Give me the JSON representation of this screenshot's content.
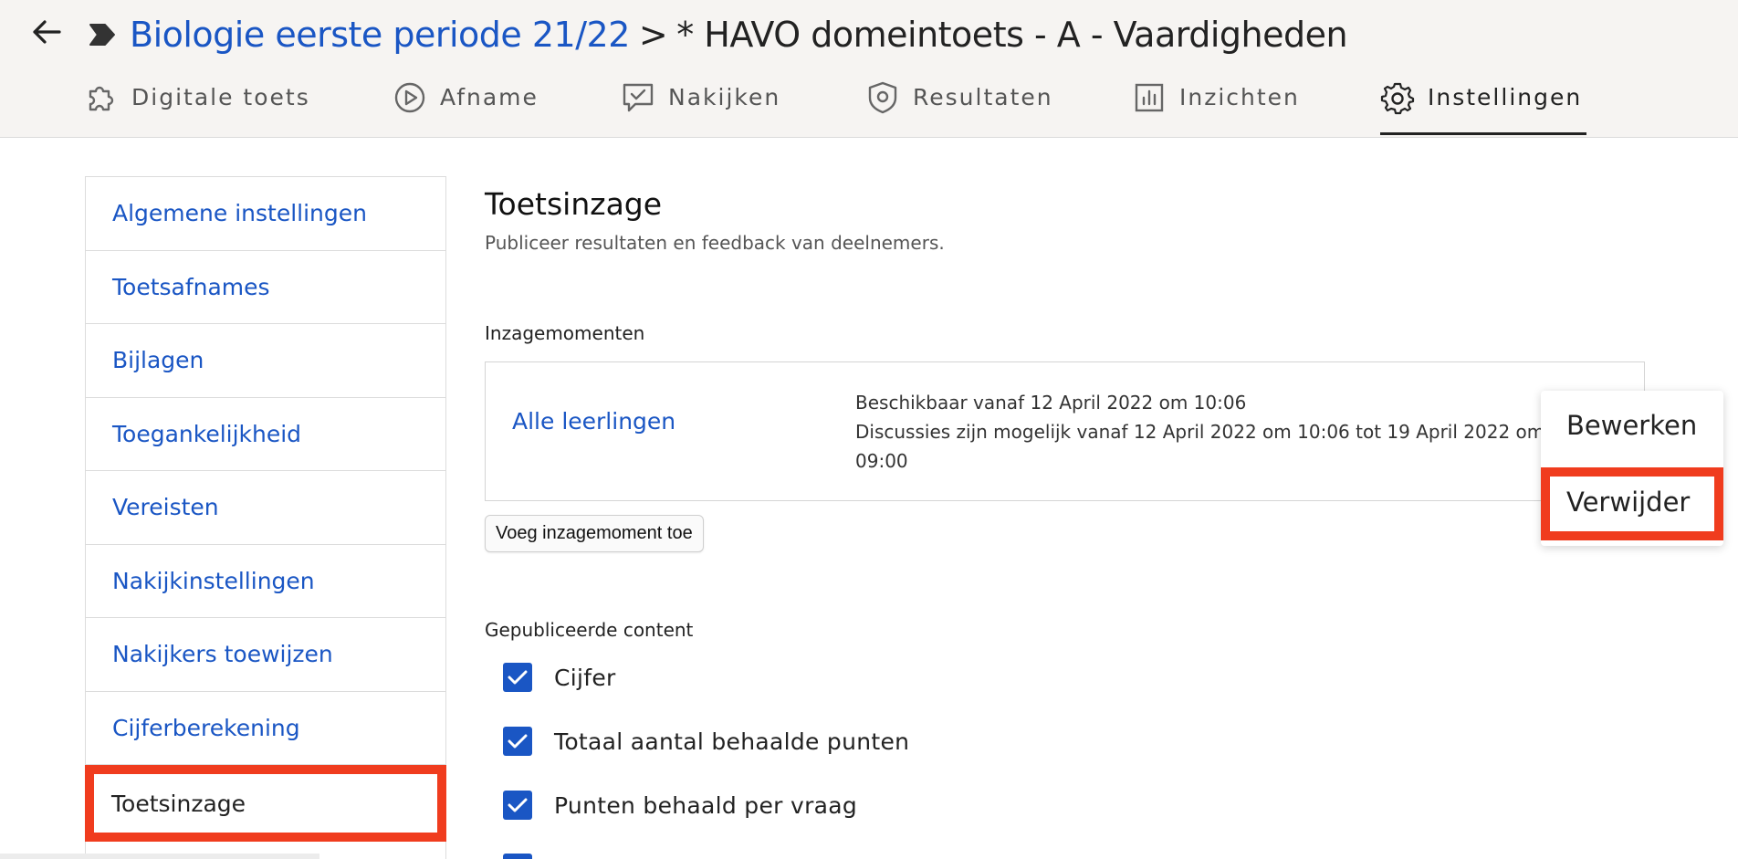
{
  "breadcrumb": {
    "parent": "Biologie eerste periode 21/22",
    "separator": ">",
    "current": "* HAVO domeintoets - A - Vaardigheden"
  },
  "tabs": [
    {
      "label": "Digitale toets",
      "icon": "puzzle-icon"
    },
    {
      "label": "Afname",
      "icon": "play-circle-icon"
    },
    {
      "label": "Nakijken",
      "icon": "chat-check-icon"
    },
    {
      "label": "Resultaten",
      "icon": "shield-icon"
    },
    {
      "label": "Inzichten",
      "icon": "bar-chart-icon"
    },
    {
      "label": "Instellingen",
      "icon": "gear-icon",
      "active": true
    }
  ],
  "sidebar": {
    "items": [
      {
        "label": "Algemene instellingen"
      },
      {
        "label": "Toetsafnames"
      },
      {
        "label": "Bijlagen"
      },
      {
        "label": "Toegankelijkheid"
      },
      {
        "label": "Vereisten"
      },
      {
        "label": "Nakijkinstellingen"
      },
      {
        "label": "Nakijkers toewijzen"
      },
      {
        "label": "Cijferberekening"
      },
      {
        "label": "Toetsinzage",
        "active": true
      }
    ]
  },
  "main": {
    "title": "Toetsinzage",
    "subtitle": "Publiceer resultaten en feedback van deelnemers.",
    "moments_label": "Inzagemomenten",
    "moment": {
      "who": "Alle leerlingen",
      "line1": "Beschikbaar vanaf 12 April 2022 om 10:06",
      "line2": "Discussies zijn mogelijk vanaf 12 April 2022 om 10:06 tot 19 April 2022 om 09:00"
    },
    "add_button": "Voeg inzagemoment toe",
    "content_label": "Gepubliceerde content",
    "checkboxes": [
      {
        "label": "Cijfer",
        "checked": true
      },
      {
        "label": "Totaal aantal behaalde punten",
        "checked": true
      },
      {
        "label": "Punten behaald per vraag",
        "checked": true
      }
    ]
  },
  "context_menu": {
    "edit": "Bewerken",
    "delete": "Verwijder"
  },
  "colors": {
    "link": "#1a56c4",
    "highlight": "#f03c1e",
    "topbar_bg": "#f6f4f2"
  }
}
